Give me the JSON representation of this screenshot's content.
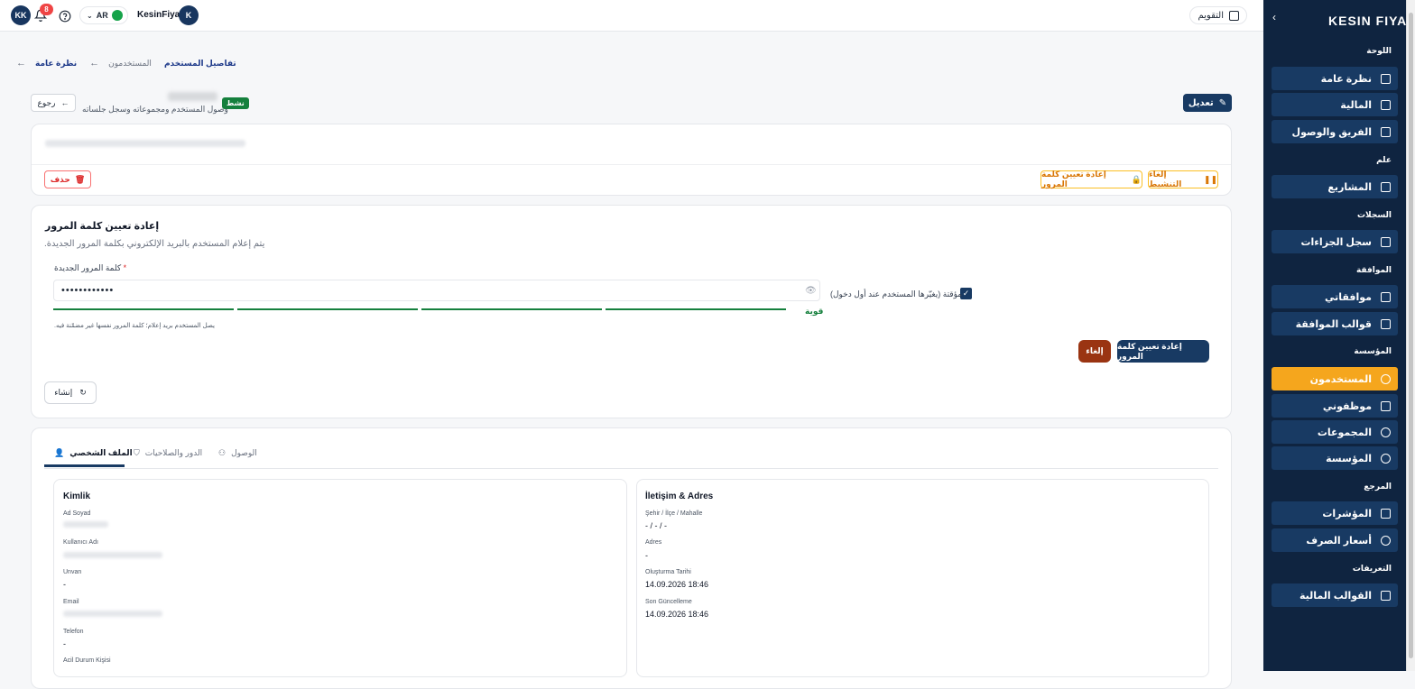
{
  "topbar": {
    "user_initials": "KK",
    "notification_count": "8",
    "language": "AR",
    "company_name": "KesinFiyat",
    "company_initial": "K",
    "calendar_label": "التقويم"
  },
  "sidebar": {
    "logo": "KESIN FIYAT",
    "sections": {
      "dashboard": "اللوحة",
      "general": "علم",
      "records": "السجلات",
      "approval": "الموافقة",
      "organization": "المؤسسة",
      "reference": "المرجع",
      "definitions": "التعريفات"
    },
    "items": {
      "overview": "نظرة عامة",
      "finance": "المالية",
      "team_access": "الفريق والوصول",
      "projects": "المشاريع",
      "penalty_log": "سجل الجزاءات",
      "my_approvals": "موافقاتي",
      "approval_templates": "قوالب الموافقة",
      "users": "المستخدمون",
      "my_employees": "موظفوني",
      "groups": "المجموعات",
      "organization": "المؤسسة",
      "indicators": "المؤشرات",
      "exchange_rates": "أسعار الصرف",
      "financial_templates": "القوالب المالية"
    }
  },
  "breadcrumb": {
    "overview": "نظرة عامة",
    "users": "المستخدمون",
    "user_details": "تفاصيل المستخدم"
  },
  "header": {
    "back_label": "رجوع",
    "status": "نشط",
    "subtitle": "وصول المستخدم ومجموعاته وسجل جلساته",
    "edit_label": "تعديل"
  },
  "actions": {
    "delete_label": "حذف",
    "reset_password_label": "إعادة تعيين كلمة المرور",
    "deactivate_label": "إلغاء التنشيط"
  },
  "reset": {
    "title": "إعادة تعيين كلمة المرور",
    "description": ".يتم إعلام المستخدم بالبريد الإلكتروني بكلمة المرور الجديدة",
    "password_label": "كلمة المرور الجديدة",
    "password_value": "••••••••••••",
    "strength": "قوية",
    "note": ".يصل المستخدم بريد إعلام؛ كلمة المرور نفسها غير مضمّنة فيه",
    "temporary_label": "مؤقتة (يغيّرها المستخدم عند أول دخول)",
    "submit_label": "إعادة تعيين كلمة المرور",
    "cancel_label": "إلغاء",
    "generate_label": "إنشاء"
  },
  "tabs": {
    "profile": "الملف الشخصي",
    "roles": "الدور والصلاحيات",
    "access": "الوصول"
  },
  "identity": {
    "title": "Kimlik",
    "name_label": "Ad Soyad",
    "username_label": "Kullanıcı Adı",
    "title_label": "Unvan",
    "title_value": "-",
    "email_label": "Email",
    "phone_label": "Telefon",
    "phone_value": "-",
    "emergency_label": "Acil Durum Kişisi"
  },
  "contact": {
    "title": "İletişim & Adres",
    "city_label": "Şehir / İlçe / Mahalle",
    "city_value": "- / - / -",
    "address_label": "Adres",
    "address_value": "-",
    "created_label": "Oluşturma Tarihi",
    "created_value": "14.09.2026 18:46",
    "updated_label": "Son Güncelleme",
    "updated_value": "14.09.2026 18:46"
  }
}
